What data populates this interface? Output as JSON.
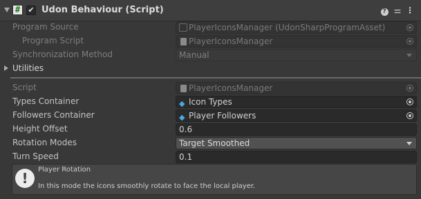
{
  "header": {
    "title": "Udon Behaviour (Script)",
    "script_icon_glyph": "#",
    "enabled_check_glyph": "✔",
    "icons": [
      "help-icon",
      "settings-icon",
      "more-icon"
    ]
  },
  "program_source": {
    "label": "Program Source",
    "value": "PlayerIconsManager (UdonSharpProgramAsset)"
  },
  "program_script": {
    "label": "Program Script",
    "value": "PlayerIconsManager"
  },
  "sync_method": {
    "label": "Synchronization Method",
    "value": "Manual"
  },
  "utilities": {
    "label": "Utilities"
  },
  "script": {
    "label": "Script",
    "value": "PlayerIconsManager"
  },
  "types_container": {
    "label": "Types Container",
    "value": "Icon Types"
  },
  "followers_container": {
    "label": "Followers Container",
    "value": "Player Followers"
  },
  "height_offset": {
    "label": "Height Offset",
    "value": "0.6"
  },
  "rotation_modes": {
    "label": "Rotation Modes",
    "value": "Target Smoothed"
  },
  "turn_speed": {
    "label": "Turn Speed",
    "value": "0.1"
  },
  "helpbox": {
    "icon_glyph": "!",
    "title": "Player Rotation",
    "body": "In this mode the icons smoothly rotate to face the local player."
  },
  "colors": {
    "background": "#383838",
    "header": "#3e3e3e",
    "field": "#2a2a2a",
    "accent_cube": "#4aa8e6"
  }
}
